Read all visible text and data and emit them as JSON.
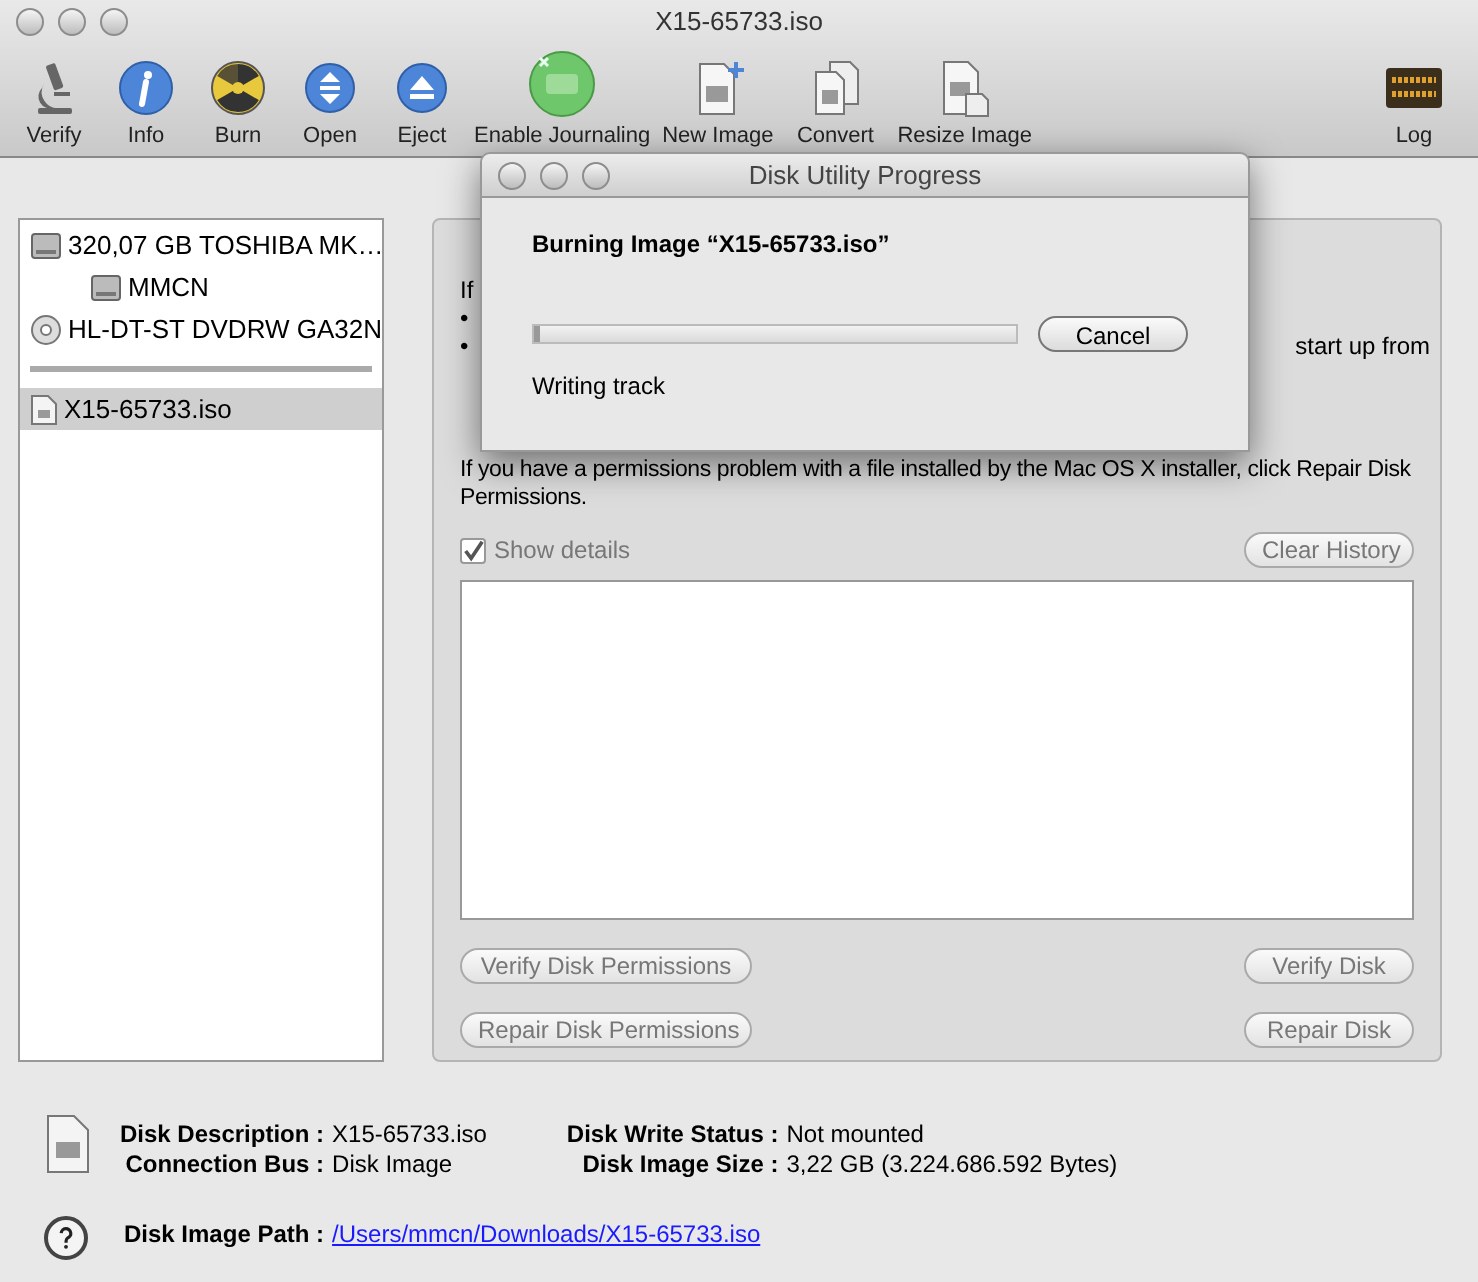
{
  "window": {
    "title": "X15-65733.iso"
  },
  "toolbar": [
    {
      "label": "Verify"
    },
    {
      "label": "Info"
    },
    {
      "label": "Burn"
    },
    {
      "label": "Open"
    },
    {
      "label": "Eject"
    },
    {
      "label": "Enable Journaling"
    },
    {
      "label": "New Image"
    },
    {
      "label": "Convert"
    },
    {
      "label": "Resize Image"
    },
    {
      "label": "Log"
    }
  ],
  "sidebar": {
    "items": [
      {
        "kind": "disk",
        "label": "320,07 GB TOSHIBA MK…",
        "selected": false,
        "children": [
          {
            "kind": "volume",
            "label": "MMCN",
            "selected": false
          }
        ]
      },
      {
        "kind": "optical",
        "label": "HL-DT-ST DVDRW GA32N",
        "selected": false
      },
      {
        "kind": "separator"
      },
      {
        "kind": "image",
        "label": "X15-65733.iso",
        "selected": true
      }
    ]
  },
  "main_panel": {
    "intro": "If",
    "bullets": [
      "•",
      "•"
    ],
    "bullet_tail": "start up from",
    "paragraph": "If you have a permissions problem with a file installed by the Mac OS X installer, click Repair Disk Permissions.",
    "show_details": {
      "label": "Show details",
      "checked": true
    },
    "clear_history": "Clear History",
    "buttons_left": [
      "Verify Disk Permissions",
      "Repair Disk Permissions"
    ],
    "buttons_right": [
      "Verify Disk",
      "Repair Disk"
    ]
  },
  "info": {
    "left": [
      {
        "label": "Disk Description :",
        "value": "X15-65733.iso"
      },
      {
        "label": "Connection Bus :",
        "value": "Disk Image"
      }
    ],
    "right": [
      {
        "label": "Disk Write Status :",
        "value": "Not mounted"
      },
      {
        "label": "Disk Image Size :",
        "value": "3,22 GB (3.224.686.592 Bytes)"
      }
    ],
    "path": {
      "label": "Disk Image Path :",
      "value": "/Users/mmcn/Downloads/X15-65733.iso"
    }
  },
  "dialog": {
    "title": "Disk Utility Progress",
    "heading": "Burning Image “X15-65733.iso”",
    "progress": {
      "level": 0.01
    },
    "cancel": "Cancel",
    "status": "Writing track"
  }
}
